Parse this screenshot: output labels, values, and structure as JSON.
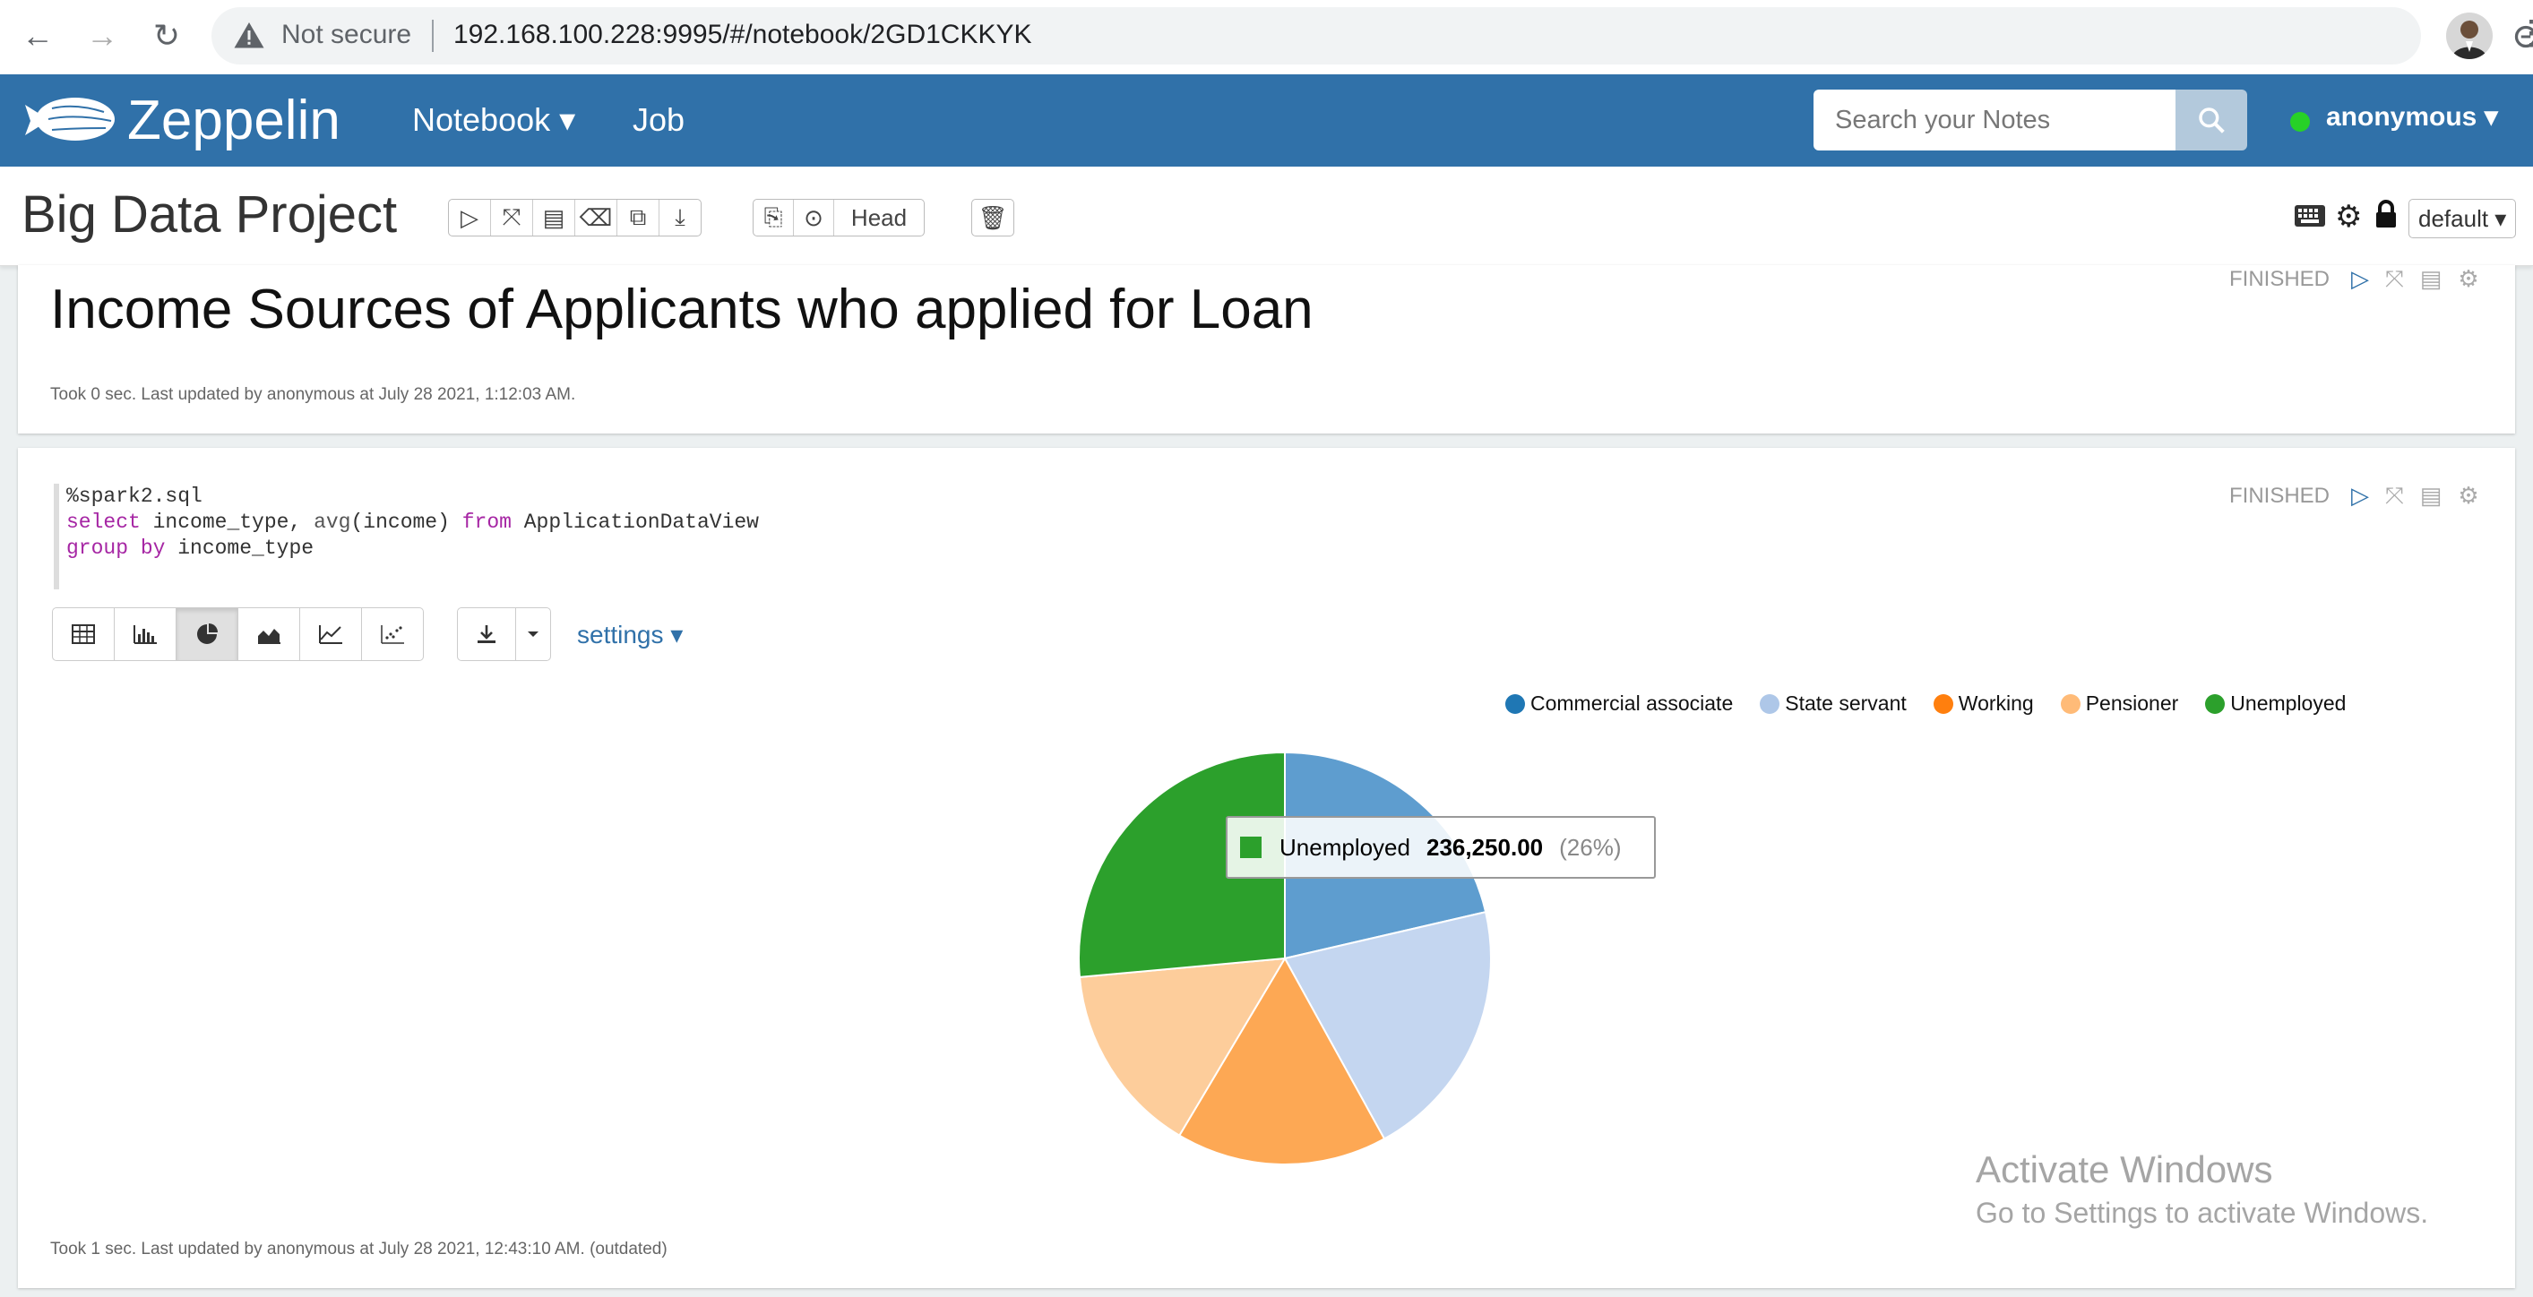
{
  "browser": {
    "not_secure": "Not secure",
    "url": "192.168.100.228:9995/#/notebook/2GD1CKKYK"
  },
  "navbar": {
    "brand": "Zeppelin",
    "notebook": "Notebook ▾",
    "job": "Job",
    "search_placeholder": "Search your Notes",
    "user": "anonymous ▾"
  },
  "notebook": {
    "title": "Big Data Project",
    "head_label": "Head",
    "interpreter_label": "default ▾"
  },
  "paragraph1": {
    "status": "FINISHED",
    "title": "Income Sources of Applicants who applied for Loan",
    "footer": "Took 0 sec. Last updated by anonymous at July 28 2021, 1:12:03 AM."
  },
  "paragraph2": {
    "status": "FINISHED",
    "code": {
      "line1": "%spark2.sql",
      "kw_select": "select",
      "sel_rest_a": " income_type, ",
      "sel_fn": "avg",
      "sel_rest_b": "(income) ",
      "kw_from": "from",
      "sel_rest_c": " ApplicationDataView",
      "kw_group": "group by",
      "grp_rest": " income_type"
    },
    "settings_label": "settings ▾",
    "footer": "Took 1 sec. Last updated by anonymous at July 28 2021, 12:43:10 AM. (outdated)"
  },
  "chart_data": {
    "type": "pie",
    "series_field": "income_type",
    "value_field": "avg(income)",
    "slices": [
      {
        "label": "Commercial associate",
        "value": 191000,
        "color": "#5e9dcf"
      },
      {
        "label": "State servant",
        "value": 184000,
        "color": "#c4d6f0"
      },
      {
        "label": "Working",
        "value": 148000,
        "color": "#fda854"
      },
      {
        "label": "Pensioner",
        "value": 134000,
        "color": "#fdcd9b"
      },
      {
        "label": "Unemployed",
        "value": 236250,
        "color": "#2ca02c"
      }
    ],
    "legend": [
      {
        "label": "Commercial associate",
        "color": "#1f77b4"
      },
      {
        "label": "State servant",
        "color": "#aec7e8"
      },
      {
        "label": "Working",
        "color": "#ff7f0e"
      },
      {
        "label": "Pensioner",
        "color": "#ffbb78"
      },
      {
        "label": "Unemployed",
        "color": "#2ca02c"
      }
    ],
    "legend_position": "top-right",
    "tooltip": {
      "label": "Unemployed",
      "value": "236,250.00",
      "percent": "(26%)",
      "color": "#2ca02c"
    }
  },
  "watermark": {
    "title": "Activate Windows",
    "subtitle": "Go to Settings to activate Windows."
  }
}
